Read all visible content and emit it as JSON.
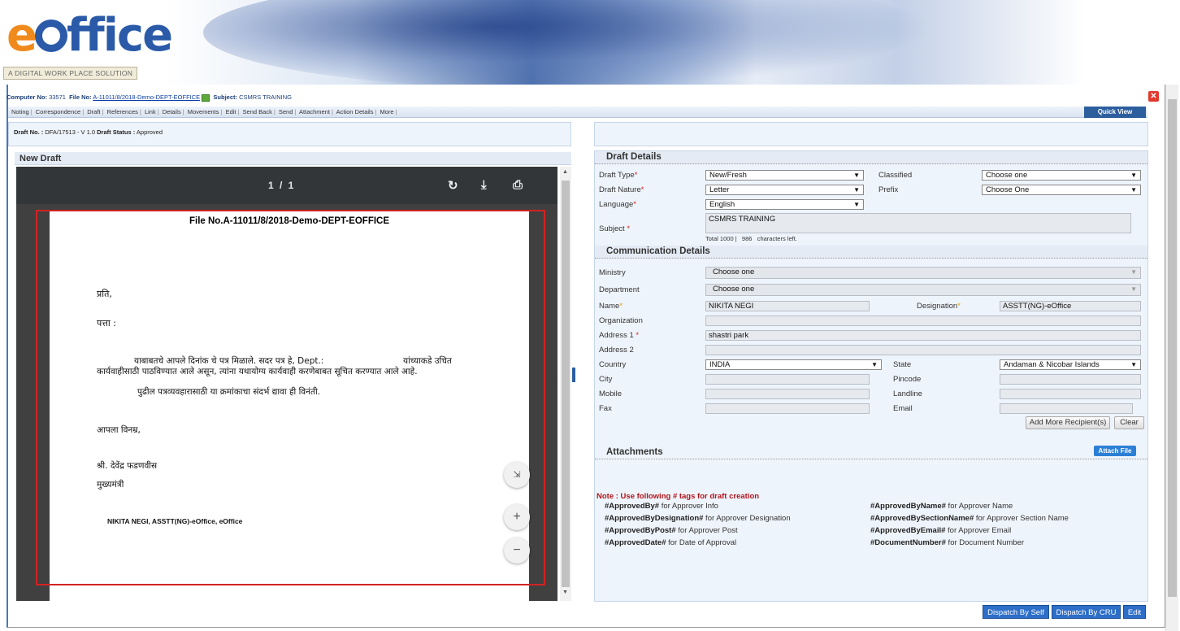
{
  "brand": {
    "logo_e": "e",
    "logo_rest": "ffice",
    "tagline": "A DIGITAL WORK PLACE SOLUTION"
  },
  "infobar": {
    "computer_label": "Computer No:",
    "computer_no": "33571",
    "file_label": "File No:",
    "file_no": "A-11011/8/2018-Demo-DEPT-EOFFICE",
    "subject_label": "Subject:",
    "subject": "CSMRS TRAINING"
  },
  "menu": [
    "Noting",
    "Correspondence",
    "Draft",
    "References",
    "Link",
    "Details",
    "Movements",
    "Edit",
    "Send Back",
    "Send",
    "Attachment",
    "Action Details",
    "More"
  ],
  "quick_view": "Quick View",
  "draft_info": {
    "draft_no_label": "Draft No. :",
    "draft_no": "DFA/17513 - V 1.0",
    "status_label": "Draft Status :",
    "status": "Approved"
  },
  "new_draft": {
    "heading": "New Draft",
    "page_indicator": "1 / 1",
    "doc_title": "File No.A-11011/8/2018-Demo-DEPT-EOFFICE",
    "line1": "प्रति,",
    "line2": "पत्ता :",
    "para1a": "याबाबतचे आपले दिनांक चे पत्र मिळाले. सदर पत्र हे, Dept.:",
    "para1b": "यांच्याकडे उचित",
    "para1c": "कार्यवाहीसाठी पाठविण्यात आले असून, त्यांना यथायोग्य कार्यवाही करणेबाबत सूचित करण्यात आले आहे.",
    "para2": "पुढील पत्रव्यवहारासाठी या क्रमांकाचा संदर्भ द्यावा ही विनंती.",
    "closing": "आपला विनम्र,",
    "sign_name": "श्री. देवेंद्र फडणवीस",
    "sign_post": "मुख्यमंत्री",
    "approver": "NIKITA NEGI, ASSTT(NG)-eOffice, eOffice"
  },
  "draft_details": {
    "heading": "Draft Details",
    "draft_type_label": "Draft Type",
    "draft_type": "New/Fresh",
    "classified_label": "Classified",
    "classified": "Choose one",
    "draft_nature_label": "Draft Nature",
    "draft_nature": "Letter",
    "prefix_label": "Prefix",
    "prefix": "Choose One",
    "language_label": "Language",
    "language": "English",
    "subject_label": "Subject",
    "subject": "CSMRS TRAINING",
    "char_total": "Total 1000 |",
    "char_left": "986",
    "char_left_suffix": "characters left."
  },
  "communication": {
    "heading": "Communication Details",
    "ministry_label": "Ministry",
    "ministry": "Choose one",
    "department_label": "Department",
    "department": "Choose one",
    "name_label": "Name",
    "name": "NIKITA NEGI",
    "designation_label": "Designation",
    "designation": "ASSTT(NG)-eOffice",
    "organization_label": "Organization",
    "organization": "",
    "address1_label": "Address 1",
    "address1": "shastri park",
    "address2_label": "Address 2",
    "address2": "",
    "country_label": "Country",
    "country": "INDIA",
    "state_label": "State",
    "state": "Andaman & Nicobar Islands",
    "city_label": "City",
    "pincode_label": "Pincode",
    "mobile_label": "Mobile",
    "landline_label": "Landline",
    "fax_label": "Fax",
    "email_label": "Email",
    "add_more": "Add More Recipient(s)",
    "clear": "Clear"
  },
  "attachments": {
    "heading": "Attachments",
    "attach_file": "Attach File",
    "note": "Note : Use following # tags for draft creation",
    "tags": [
      {
        "tag": "#ApprovedBy#",
        "desc": " for Approver Info"
      },
      {
        "tag": "#ApprovedByName#",
        "desc": " for Approver Name"
      },
      {
        "tag": "#ApprovedByDesignation#",
        "desc": " for Approver Designation"
      },
      {
        "tag": "#ApprovedBySectionName#",
        "desc": " for Approver Section Name"
      },
      {
        "tag": "#ApprovedByPost#",
        "desc": " for Approver Post"
      },
      {
        "tag": "#ApprovedByEmail#",
        "desc": " for Approver Email"
      },
      {
        "tag": "#ApprovedDate#",
        "desc": " for Date of Approval"
      },
      {
        "tag": "#DocumentNumber#",
        "desc": " for Document Number"
      }
    ]
  },
  "footer_buttons": {
    "dispatch_self": "Dispatch By Self",
    "dispatch_cru": "Dispatch By CRU",
    "edit": "Edit"
  },
  "icons": {
    "rotate": "rotate-icon",
    "download": "download-icon",
    "print": "print-icon",
    "fit": "fit-page-icon",
    "zoom_in": "zoom-in-icon",
    "zoom_out": "zoom-out-icon",
    "close": "close-icon",
    "file_open": "file-open-icon"
  },
  "colors": {
    "brand_orange": "#f08a1c",
    "brand_blue": "#2a5aa8",
    "accent_blue": "#2c5e9e",
    "note_red": "#b3141a"
  }
}
